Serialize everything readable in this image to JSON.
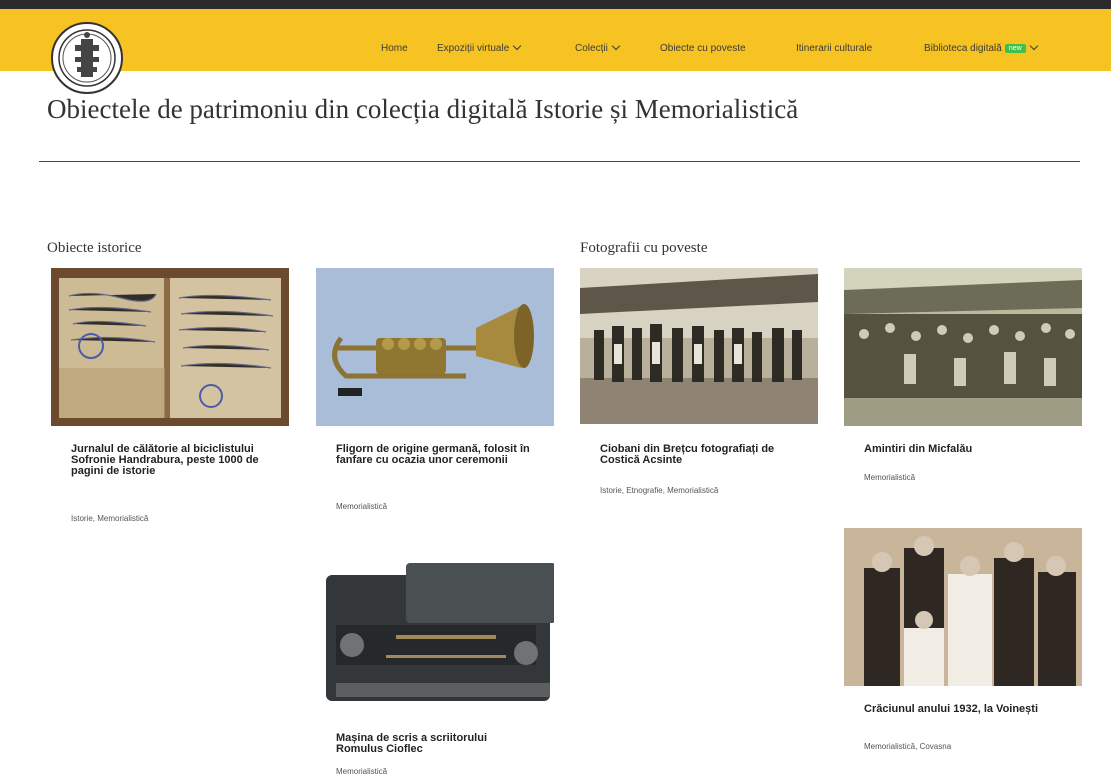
{
  "nav": {
    "items": [
      {
        "label": "Home"
      },
      {
        "label": "Expoziții virtuale"
      },
      {
        "label": "Colecții"
      },
      {
        "label": "Obiecte cu poveste"
      },
      {
        "label": "Itinerarii culturale"
      },
      {
        "label": "Biblioteca digitală"
      }
    ],
    "badge": "new"
  },
  "page": {
    "title": "Obiectele de patrimoniu din colecția digitală Istorie și Memorialistică"
  },
  "sections": {
    "left": "Obiecte istorice",
    "right": "Fotografii cu poveste"
  },
  "cards": [
    {
      "title": "Jurnalul de călătorie al biciclistului Sofronie Handrabura, peste 1000 de pagini de istorie",
      "tags": "Istorie, Memorialistică"
    },
    {
      "title": "Fligorn de origine germană, folosit în fanfare cu ocazia unor ceremonii",
      "tags": "Memorialistică"
    },
    {
      "title": "Ciobani din Brețcu fotografiați de Costică Acsinte",
      "tags": "Istorie, Etnografie, Memorialistică"
    },
    {
      "title": "Amintiri din Micfalău",
      "tags": "Memorialistică"
    },
    {
      "title": "Mașina de scris a scriitorului Romulus Cioflec",
      "tags": "Memorialistică"
    },
    {
      "title": "Crăciunul anului 1932, la Voinești",
      "tags": "Memorialistică, Covasna"
    }
  ]
}
